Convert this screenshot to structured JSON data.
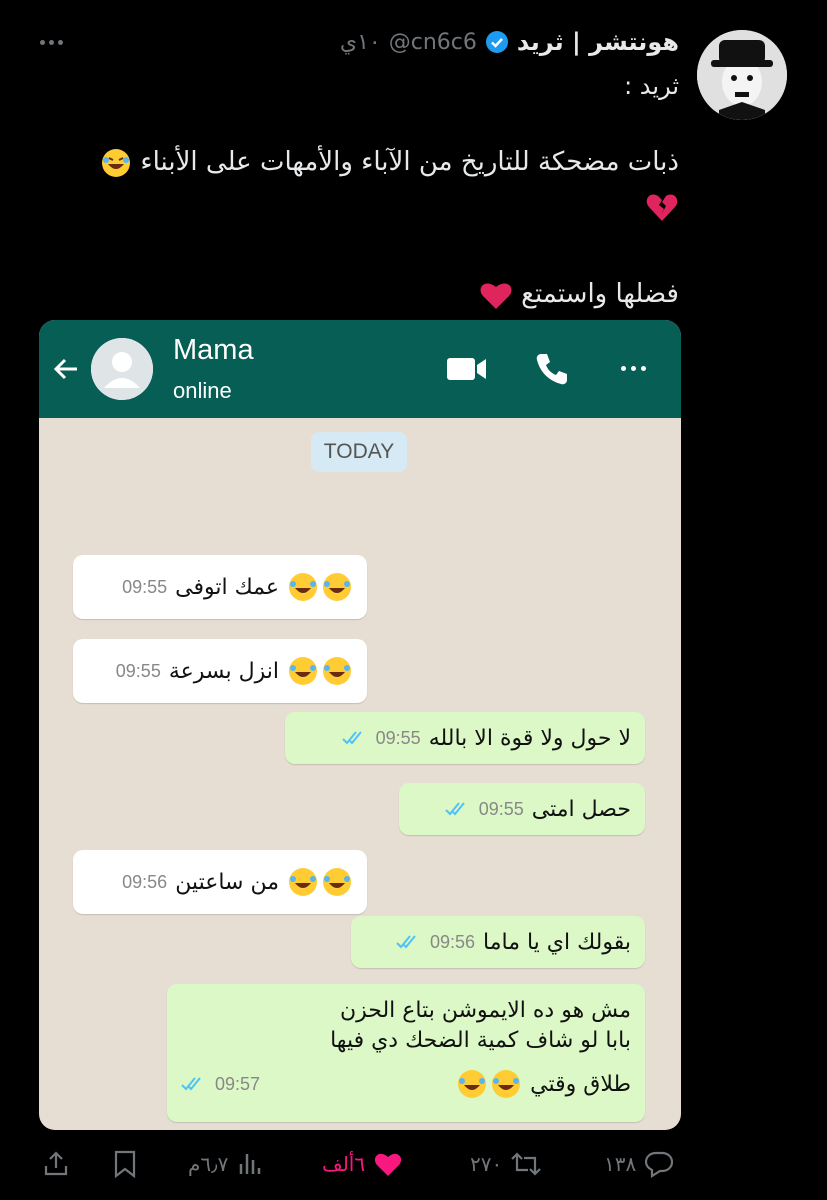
{
  "tweet": {
    "author_name": "هونتشر | ثريد",
    "handle": "@cn6c6",
    "age": "١٠ي",
    "label": "ثريد :",
    "line1": "ذبات مضحكة للتاريخ من الآباء والأمهات على الأبناء",
    "line3": "فضلها واستمتع"
  },
  "whatsapp": {
    "contact_name": "Mama",
    "status": "online",
    "date_chip": "TODAY",
    "messages": [
      {
        "dir": "in",
        "text": "عمك اتوفى",
        "time": "09:55"
      },
      {
        "dir": "in",
        "text": "انزل بسرعة",
        "time": "09:55"
      },
      {
        "dir": "out",
        "text": "لا حول ولا قوة الا بالله",
        "time": "09:55"
      },
      {
        "dir": "out",
        "text": "حصل امتى",
        "time": "09:55"
      },
      {
        "dir": "in",
        "text": "من ساعتين",
        "time": "09:56"
      },
      {
        "dir": "out",
        "text": "بقولك اي يا ماما",
        "time": "09:56"
      },
      {
        "dir": "out",
        "text_line1": "مش هو ده الايموشن بتاع الحزن",
        "text_line2": "بابا لو شاف كمية الضحك دي فيها",
        "text_line3": "طلاق وقتي",
        "time": "09:57"
      }
    ]
  },
  "actions": {
    "replies": "١٣٨",
    "retweets": "٢٧٠",
    "likes": "٦ألف",
    "views": "٦٫٧م"
  },
  "colors": {
    "wa_header": "#075e54",
    "like": "#f91880"
  }
}
